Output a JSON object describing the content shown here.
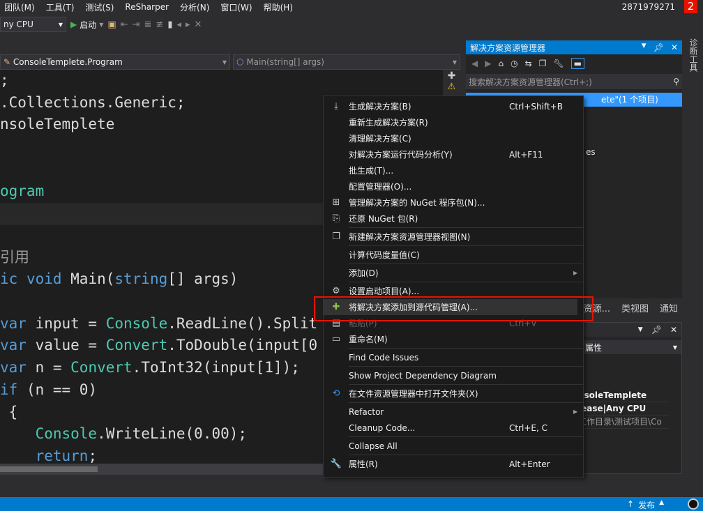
{
  "menubar": [
    "团队(M)",
    "工具(T)",
    "测试(S)",
    "ReSharper",
    "分析(N)",
    "窗口(W)",
    "帮助(H)"
  ],
  "account": "2871979271",
  "notification_count": "2",
  "toolbar": {
    "platform": "ny CPU",
    "start": "启动"
  },
  "navbar": {
    "class": "ConsoleTemplete.Program",
    "member": "Main(string[] args)"
  },
  "code": [
    [
      [
        ";",
        "tx"
      ]
    ],
    [
      [
        ".Collections.Generic;",
        "tx"
      ]
    ],
    [
      [
        "nsoleTemplete",
        "tx"
      ]
    ],
    [],
    [],
    [
      [
        "ogram",
        "ty"
      ]
    ],
    [],
    [],
    [
      [
        "引用",
        "cm"
      ]
    ],
    [
      [
        "ic ",
        "kw"
      ],
      [
        "void ",
        "kw"
      ],
      [
        "Main(",
        "tx"
      ],
      [
        "string",
        "kw"
      ],
      [
        "[] args)",
        "tx"
      ]
    ],
    [],
    [
      [
        "var ",
        "kw"
      ],
      [
        "input = ",
        "tx"
      ],
      [
        "Console",
        "ty"
      ],
      [
        ".ReadLine().Split",
        "tx"
      ]
    ],
    [
      [
        "var ",
        "kw"
      ],
      [
        "value = ",
        "tx"
      ],
      [
        "Convert",
        "ty"
      ],
      [
        ".ToDouble(input[0",
        "tx"
      ]
    ],
    [
      [
        "var ",
        "kw"
      ],
      [
        "n = ",
        "tx"
      ],
      [
        "Convert",
        "ty"
      ],
      [
        ".ToInt32(input[1]);",
        "tx"
      ]
    ],
    [
      [
        "if ",
        "kw"
      ],
      [
        "(n == 0)",
        "tx"
      ]
    ],
    [
      [
        " {",
        "tx"
      ]
    ],
    [
      [
        "    ",
        "tx"
      ],
      [
        "Console",
        "ty"
      ],
      [
        ".WriteLine(0.00);",
        "tx"
      ]
    ],
    [
      [
        "    ",
        "tx"
      ],
      [
        "return",
        "kw"
      ],
      [
        ";",
        "tx"
      ]
    ]
  ],
  "solution_explorer": {
    "title": "解决方案资源管理器",
    "search_placeholder": "搜索解决方案资源管理器(Ctrl+;)",
    "selected_item": "ete\"(1 个项目)",
    "partial_item": "es"
  },
  "tabs": [
    "队资源...",
    "类视图",
    "通知"
  ],
  "properties": {
    "dropdown": "属性",
    "rows": [
      "nsoleTemplete",
      "lease|Any CPU",
      "工作目录\\测试项目\\Co"
    ]
  },
  "right_strip": "诊断工具",
  "status": {
    "publish": "发布"
  },
  "context_menu": [
    {
      "icon": "build-icon",
      "glyph": "⤓",
      "label": "生成解决方案(B)",
      "shortcut": "Ctrl+Shift+B"
    },
    {
      "label": "重新生成解决方案(R)"
    },
    {
      "label": "清理解决方案(C)"
    },
    {
      "label": "对解决方案运行代码分析(Y)",
      "shortcut": "Alt+F11"
    },
    {
      "label": "批生成(T)..."
    },
    {
      "label": "配置管理器(O)..."
    },
    {
      "icon": "nuget-icon",
      "glyph": "⊞",
      "label": "管理解决方案的 NuGet 程序包(N)..."
    },
    {
      "icon": "restore-icon",
      "glyph": "⎘",
      "label": "还原 NuGet 包(R)",
      "sep": true
    },
    {
      "icon": "new-view-icon",
      "glyph": "❐",
      "label": "新建解决方案资源管理器视图(N)",
      "sep": true
    },
    {
      "label": "计算代码度量值(C)",
      "sep": true
    },
    {
      "label": "添加(D)",
      "submenu": true,
      "sep": true
    },
    {
      "icon": "gear-icon",
      "glyph": "⚙",
      "label": "设置启动项目(A)..."
    },
    {
      "icon": "add-source-control-icon",
      "glyph": "✚",
      "label": "将解决方案添加到源代码管理(A)...",
      "highlighted": true
    },
    {
      "icon": "paste-icon",
      "glyph": "▤",
      "label": "粘贴(P)",
      "shortcut": "Ctrl+V",
      "disabled": true
    },
    {
      "icon": "rename-icon",
      "glyph": "▭",
      "label": "重命名(M)",
      "sep": true
    },
    {
      "label": "Find Code Issues",
      "sep": true
    },
    {
      "label": "Show Project Dependency Diagram",
      "sep": true
    },
    {
      "icon": "refresh-folder-icon",
      "glyph": "⟲",
      "label": "在文件资源管理器中打开文件夹(X)",
      "sep": true
    },
    {
      "label": "Refactor",
      "submenu": true
    },
    {
      "label": "Cleanup Code...",
      "shortcut": "Ctrl+E, C",
      "sep": true
    },
    {
      "label": "Collapse All",
      "sep": true
    },
    {
      "icon": "wrench-icon",
      "glyph": "🔧",
      "label": "属性(R)",
      "shortcut": "Alt+Enter"
    }
  ],
  "colors": {
    "accent": "#007acc",
    "highlight_box": "#e51400",
    "selection": "#3399ff"
  }
}
